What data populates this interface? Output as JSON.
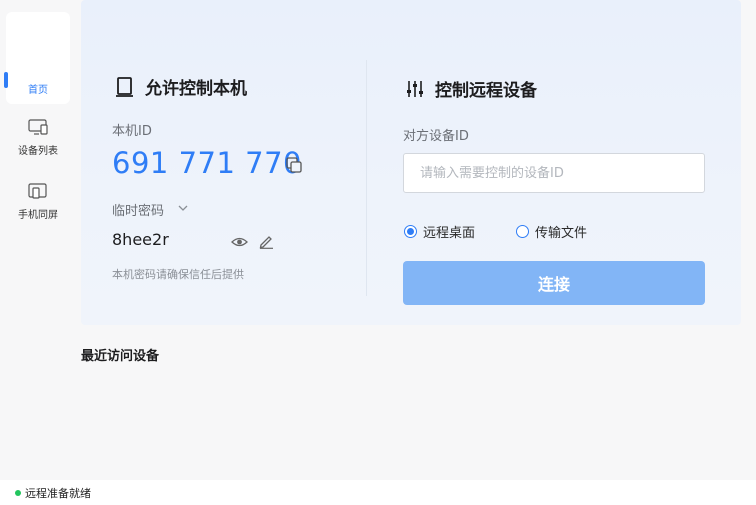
{
  "sidebar": {
    "items": [
      {
        "label": "首页",
        "icon": "home-icon",
        "active": true
      },
      {
        "label": "设备列表",
        "icon": "monitor-icon"
      },
      {
        "label": "手机同屏",
        "icon": "phone-mirror-icon"
      }
    ]
  },
  "allow": {
    "title": "允许控制本机",
    "id_label": "本机ID",
    "device_id": "691 771 770",
    "pwd_label": "临时密码",
    "password": "8hee2r",
    "hint": "本机密码请确保信任后提供"
  },
  "remote": {
    "title": "控制远程设备",
    "peer_label": "对方设备ID",
    "peer_placeholder": "请输入需要控制的设备ID",
    "peer_value": "",
    "mode_desktop": "远程桌面",
    "mode_file": "传输文件",
    "selected_mode": "远程桌面",
    "connect_label": "连接"
  },
  "recent": {
    "title": "最近访问设备"
  },
  "status": {
    "text": "远程准备就绪"
  },
  "colors": {
    "accent": "#2f7df6",
    "button": "#82b5f6",
    "status_ok": "#22c55e"
  }
}
